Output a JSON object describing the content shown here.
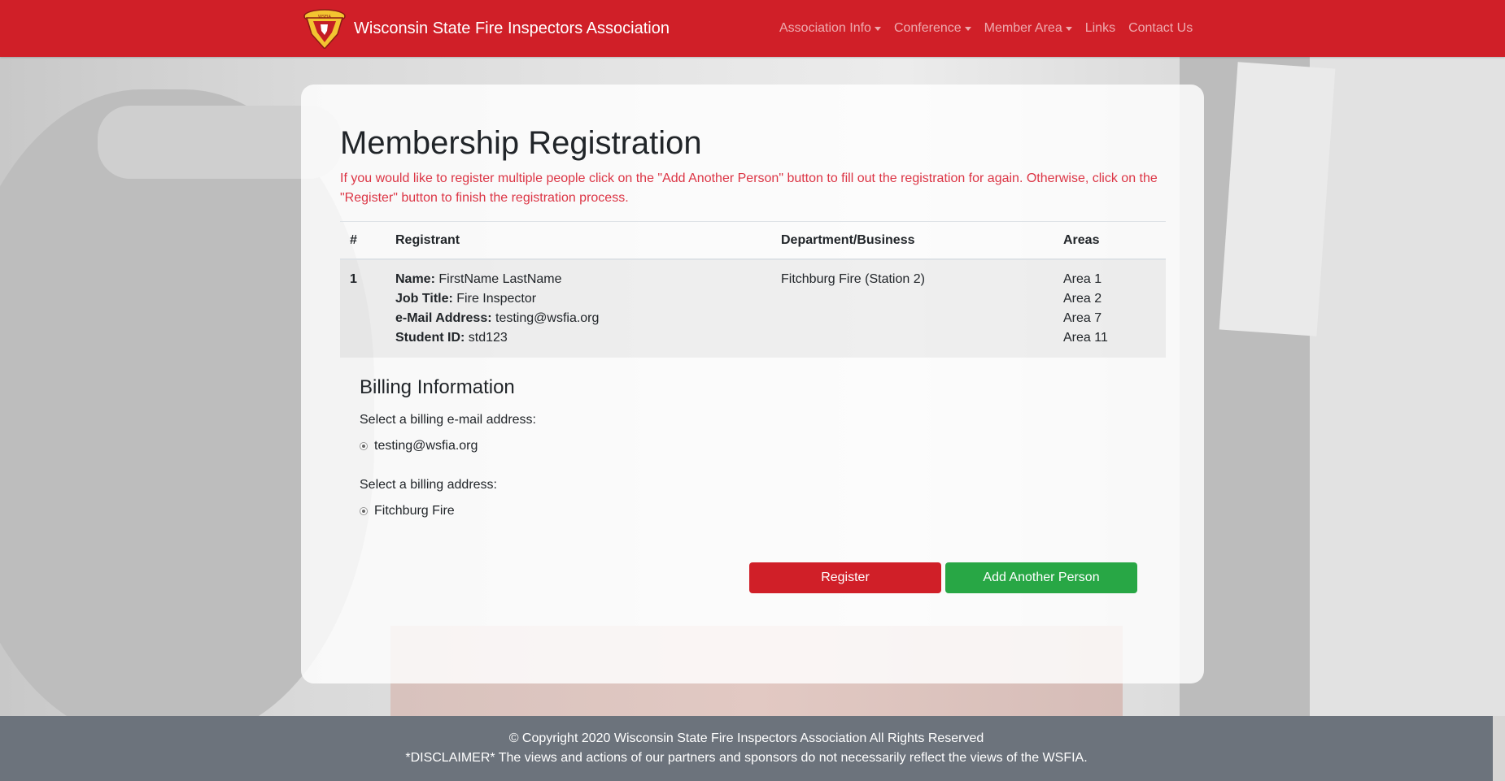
{
  "header": {
    "brand": "Wisconsin State Fire Inspectors Association",
    "nav": [
      {
        "label": "Association Info",
        "dropdown": true
      },
      {
        "label": "Conference",
        "dropdown": true
      },
      {
        "label": "Member Area",
        "dropdown": true
      },
      {
        "label": "Links",
        "dropdown": false
      },
      {
        "label": "Contact Us",
        "dropdown": false
      }
    ]
  },
  "main": {
    "title": "Membership Registration",
    "intro": "If you would like to register multiple people click on the \"Add Another Person\" button to fill out the registration for again. Otherwise, click on the \"Register\" button to finish the registration process.",
    "table": {
      "headers": [
        "#",
        "Registrant",
        "Department/Business",
        "Areas"
      ],
      "rows": [
        {
          "num": "1",
          "name_label": "Name:",
          "name": "FirstName LastName",
          "job_label": "Job Title:",
          "job": "Fire Inspector",
          "email_label": "e-Mail Address:",
          "email": "testing@wsfia.org",
          "student_label": "Student ID:",
          "student": "std123",
          "department": "Fitchburg Fire (Station 2)",
          "areas": [
            "Area 1",
            "Area 2",
            "Area 7",
            "Area 11"
          ]
        }
      ]
    },
    "billing": {
      "heading": "Billing Information",
      "email_prompt": "Select a billing e-mail address:",
      "email_option": "testing@wsfia.org",
      "address_prompt": "Select a billing address:",
      "address_option": "Fitchburg Fire"
    },
    "buttons": {
      "register": "Register",
      "add_another": "Add Another Person"
    }
  },
  "footer": {
    "copyright": "© Copyright 2020 Wisconsin State Fire Inspectors Association All Rights Reserved",
    "disclaimer": "*DISCLAIMER* The views and actions of our partners and sponsors do not necessarily reflect the views of the WSFIA."
  },
  "colors": {
    "brand_red": "#d01f28",
    "success_green": "#28a745",
    "intro_red": "#dc3545",
    "footer_gray": "#6c737c"
  }
}
